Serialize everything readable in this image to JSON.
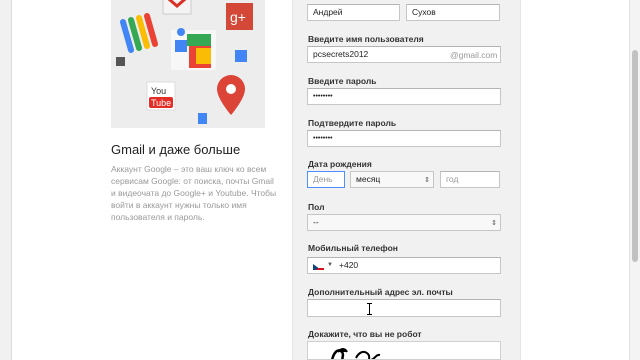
{
  "promo": {
    "title": "Gmail и даже больше",
    "text": "Аккаунт Google – это ваш ключ ко всем сервисам Google: от поиска, почты Gmail и видеочата до Google+ и Youtube. Чтобы войти в аккаунт нужны только имя пользователя и пароль.",
    "youtube_top": "You",
    "youtube_bottom": "Tube",
    "gplus": "g+"
  },
  "form": {
    "first_name": "Андрей",
    "last_name": "Сухов",
    "username_label": "Введите имя пользователя",
    "username_value": "pcsecrets2012",
    "domain_suffix": "@gmail.com",
    "password_label": "Введите пароль",
    "password_value": "••••••••",
    "confirm_label": "Подтвердите пароль",
    "confirm_value": "••••••••",
    "birthdate_label": "Дата рождения",
    "day_placeholder": "День",
    "month_value": "месяц",
    "year_placeholder": "год",
    "gender_label": "Пол",
    "gender_value": "--",
    "phone_label": "Мобильный телефон",
    "phone_value": "+420",
    "alt_email_label": "Дополнительный адрес эл. почты",
    "alt_email_value": "",
    "captcha_label": "Докажите, что вы не робот"
  },
  "colors": {
    "panel_bg": "#f1f1f1",
    "focus_border": "#4d90fe",
    "label_text": "#333333"
  }
}
